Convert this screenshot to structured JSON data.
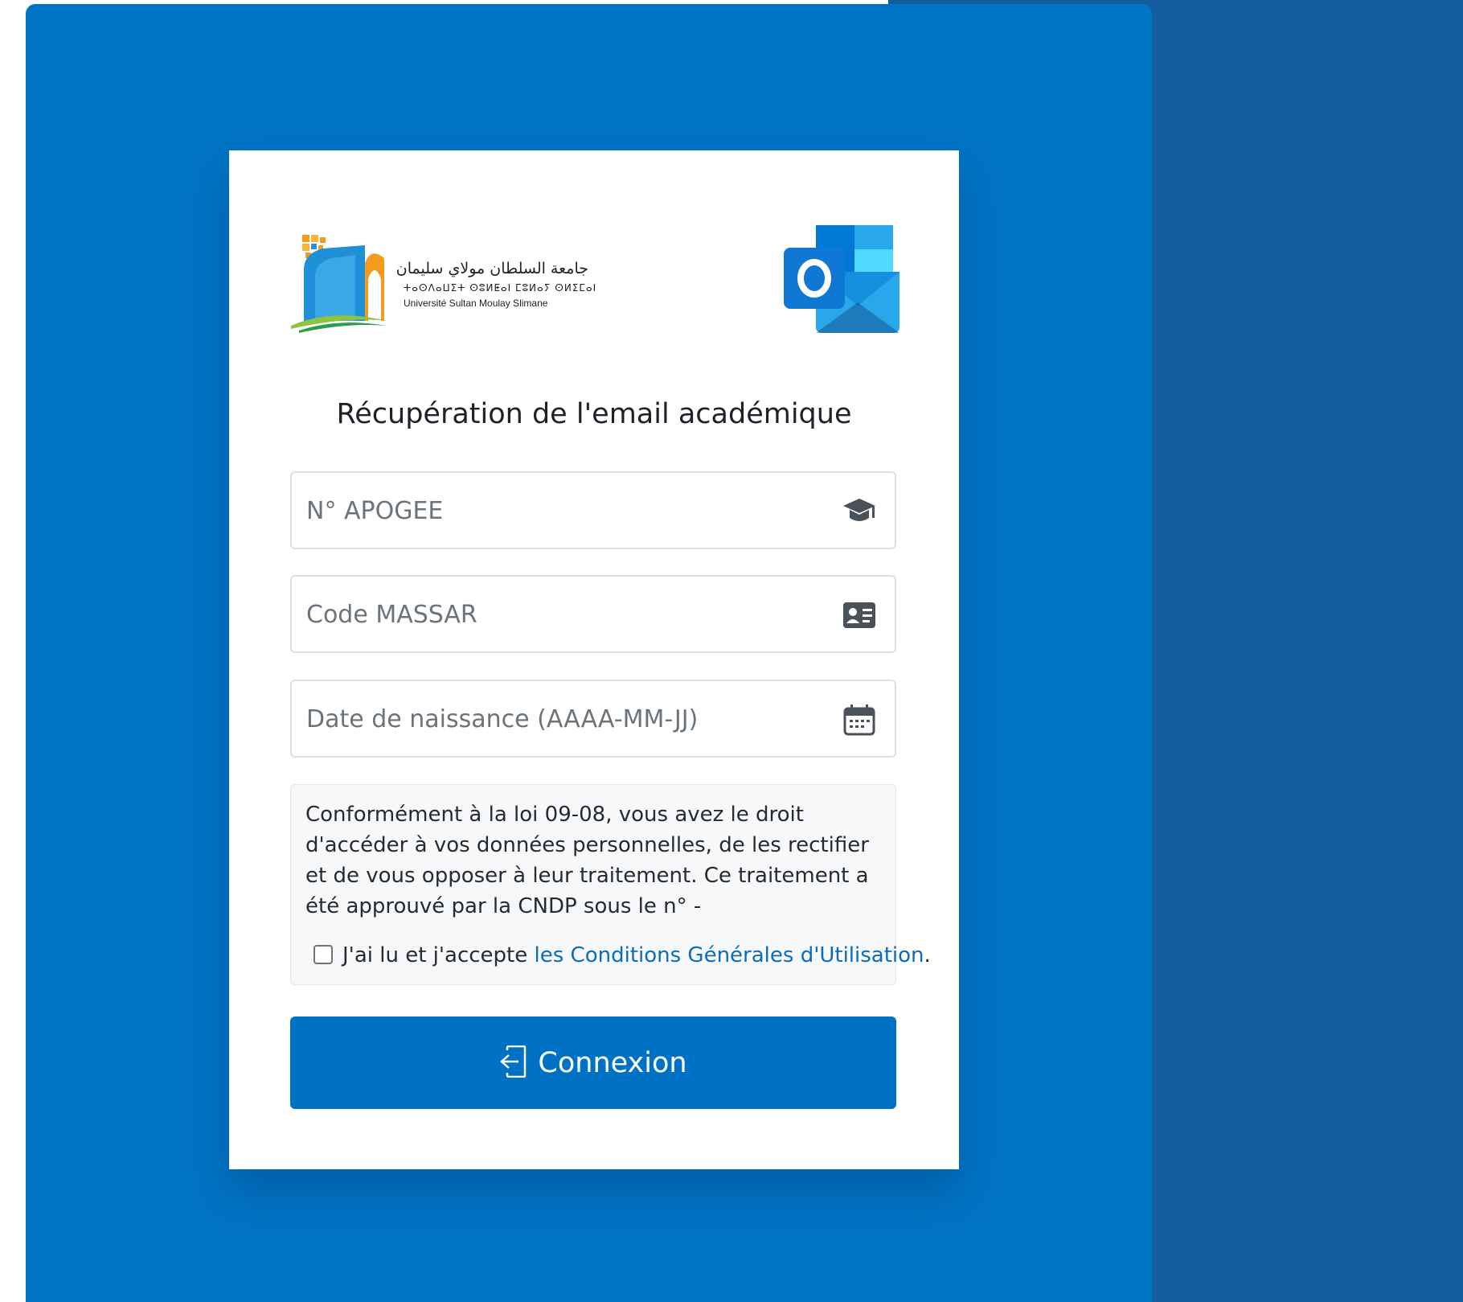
{
  "logo": {
    "arabic_name": "جامعة السلطان مولاي سليمان",
    "tifinagh_name": "ⵜⴰⵙⴷⴰⵡⵉⵜ ⵙⵓⵍⵟⴰⵏ ⵎⵓⵍⴰⵢ ⵙⵍⵉⵎⴰⵏ",
    "french_name": "Université Sultan Moulay Slimane"
  },
  "title": "Récupération de l'email académique",
  "fields": {
    "apogee": {
      "placeholder": "N° APOGEE",
      "value": "",
      "icon": "graduation-cap-icon"
    },
    "massar": {
      "placeholder": "Code MASSAR",
      "value": "",
      "icon": "id-card-icon"
    },
    "birthdate": {
      "placeholder": "Date de naissance (AAAA-MM-JJ)",
      "value": "",
      "icon": "calendar-icon"
    }
  },
  "notice": {
    "text": "Conformément à la loi 09-08, vous avez le droit d'accéder à vos données personnelles, de les rectifier et de vous opposer à leur traitement. Ce traitement a été approuvé par la CNDP sous le n° -",
    "consent_prefix": "J'ai lu et j'accepte ",
    "consent_link": "les Conditions Générales d'Utilisation",
    "consent_suffix": ".",
    "checked": false
  },
  "submit": {
    "label": "Connexion",
    "icon": "sign-in-icon"
  },
  "colors": {
    "background": "#0074c5",
    "right_panel": "#155c9f",
    "button": "#0072c6",
    "link": "#0b6cbd"
  }
}
